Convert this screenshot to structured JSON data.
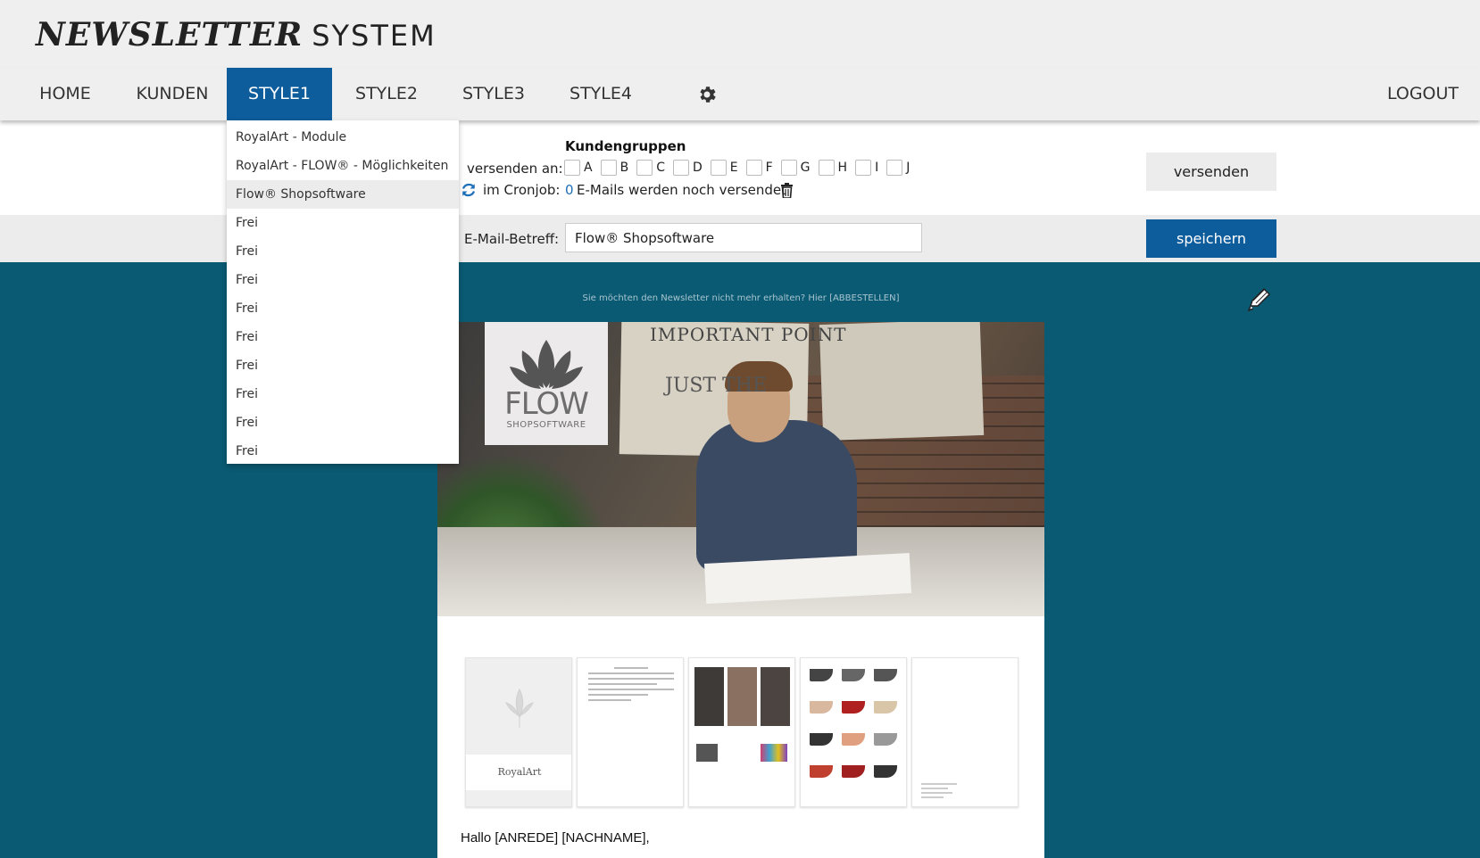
{
  "brand": {
    "bold": "NEWSLETTER",
    "light": "SYSTEM"
  },
  "nav": {
    "items": [
      {
        "label": "HOME"
      },
      {
        "label": "KUNDEN"
      },
      {
        "label": "STYLE1"
      },
      {
        "label": "STYLE2"
      },
      {
        "label": "STYLE3"
      },
      {
        "label": "STYLE4"
      }
    ],
    "active": "STYLE1",
    "settings_icon": "gear-icon",
    "logout": "LOGOUT"
  },
  "dropdown": {
    "items": [
      "RoyalArt - Module",
      "RoyalArt - FLOW® - Möglichkeiten",
      "Flow® Shopsoftware",
      "Frei",
      "Frei",
      "Frei",
      "Frei",
      "Frei",
      "Frei",
      "Frei",
      "Frei",
      "Frei"
    ],
    "highlighted": "Flow® Shopsoftware"
  },
  "form": {
    "kundengruppen_title": "Kundengruppen",
    "versenden_label": "versenden an:",
    "groups": [
      "A",
      "B",
      "C",
      "D",
      "E",
      "F",
      "G",
      "H",
      "I",
      "J"
    ],
    "cronjob_label": "im Cronjob:",
    "cronjob_count": "0",
    "cronjob_text": "E-Mails werden noch versendet",
    "subject_label": "E-Mail-Betreff:",
    "subject_value": "Flow® Shopsoftware",
    "send_button": "versenden",
    "save_button": "speichern"
  },
  "newsletter": {
    "unsubscribe_text": "Sie möchten den Newsletter nicht mehr erhalten? Hier [ABBESTELLEN]",
    "hero_note": "IMPORTANT POINT",
    "hero_note2": "JUST THE",
    "logo_text": "FLOW",
    "logo_sub": "SHOPSOFTWARE",
    "thumb1_logo": "RoyalArt",
    "greeting": "Hallo [ANREDE] [NACHNAME],"
  },
  "colors": {
    "primary": "#0d5c9c",
    "background_teal": "#0a5a73",
    "header_bg": "#efefef",
    "cron_count": "#1d6fb8"
  }
}
